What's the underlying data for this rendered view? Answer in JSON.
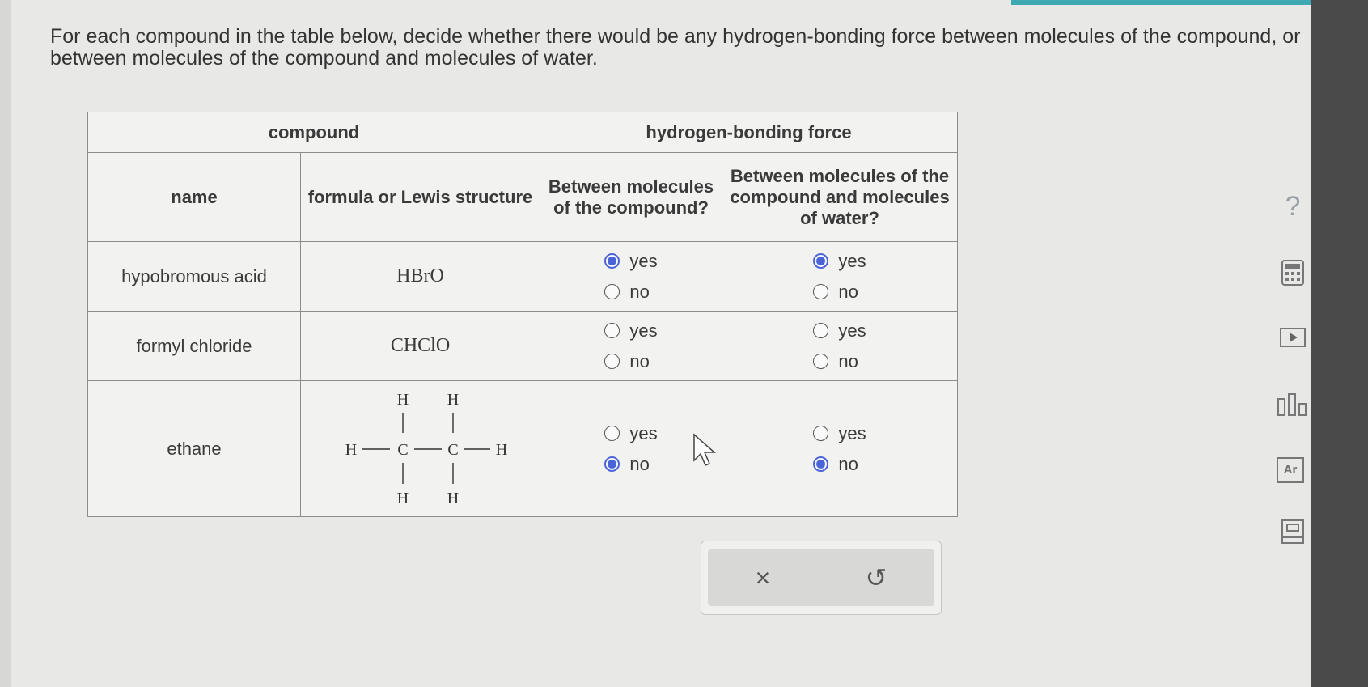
{
  "prompt": "For each compound in the table below, decide whether there would be any hydrogen-bonding force between molecules of the compound, or between molecules of the compound and molecules of water.",
  "table": {
    "group_headers": [
      "compound",
      "hydrogen-bonding force"
    ],
    "column_headers": [
      "name",
      "formula or Lewis structure",
      "Between molecules of the compound?",
      "Between molecules of the compound and molecules of water?"
    ],
    "rows": [
      {
        "name": "hypobromous acid",
        "formula": "HBrO",
        "q1": {
          "yes": "yes",
          "no": "no",
          "selected": "yes"
        },
        "q2": {
          "yes": "yes",
          "no": "no",
          "selected": "yes"
        }
      },
      {
        "name": "formyl chloride",
        "formula": "CHClO",
        "q1": {
          "yes": "yes",
          "no": "no",
          "selected": null
        },
        "q2": {
          "yes": "yes",
          "no": "no",
          "selected": null
        }
      },
      {
        "name": "ethane",
        "formula": "lewis-structure",
        "lewis_atoms": [
          "H",
          "H",
          "H",
          "C",
          "C",
          "H",
          "H",
          "H"
        ],
        "q1": {
          "yes": "yes",
          "no": "no",
          "selected": "no"
        },
        "q2": {
          "yes": "yes",
          "no": "no",
          "selected": "no"
        }
      }
    ]
  },
  "actions": {
    "clear_icon": "×",
    "undo_icon": "↺"
  },
  "side_tools": {
    "help": "?",
    "calculator_icon": "calculator-icon",
    "video_icon": "video-icon",
    "chart_icon": "chart-icon",
    "periodic_table": "Ar",
    "reference_icon": "reference-icon"
  },
  "colors": {
    "accent": "#4a64d8",
    "topbar": "#3fa9b3"
  }
}
